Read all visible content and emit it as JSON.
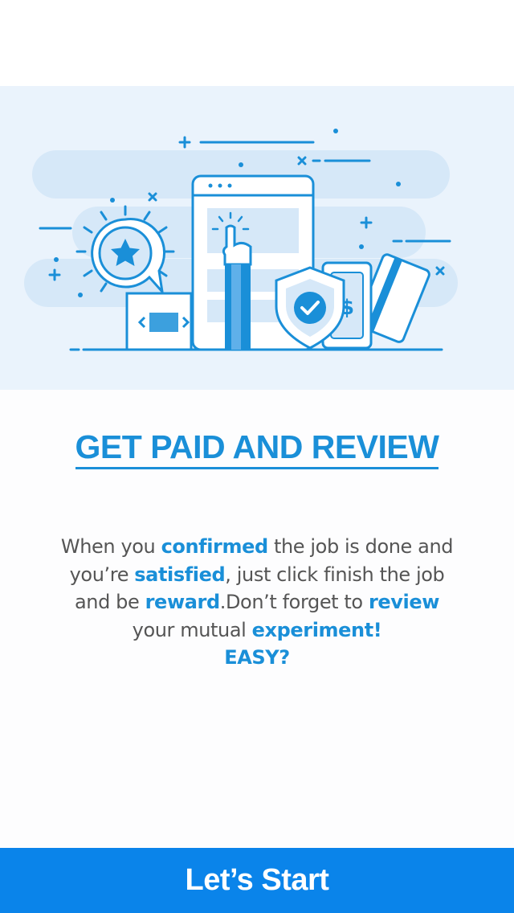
{
  "screen": {
    "title": "GET PAID AND REVIEW",
    "description": {
      "line1": {
        "pre": "When you ",
        "hl": "confirmed",
        "post": " the job is done and"
      },
      "line2": {
        "pre": "you’re ",
        "hl": "satisfied",
        "post": ", just click finish the job"
      },
      "line3": {
        "pre": "and be ",
        "hl1": "reward",
        "mid": ".Don’t forget to ",
        "hl2": "review"
      },
      "line4": {
        "pre": "your mutual ",
        "hl": "experiment!"
      },
      "easy": "EASY?"
    }
  },
  "cta": {
    "label": "Let’s Start"
  },
  "illustration": {
    "icons": [
      "star-badge-icon",
      "browser-window-icon",
      "pointing-hand-icon",
      "shield-check-icon",
      "money-icon",
      "credit-card-icon"
    ]
  },
  "colors": {
    "accent": "#1a8fd8",
    "button": "#0a84ea",
    "illustration_bg": "#eaf3fc",
    "body_text": "#555555"
  }
}
